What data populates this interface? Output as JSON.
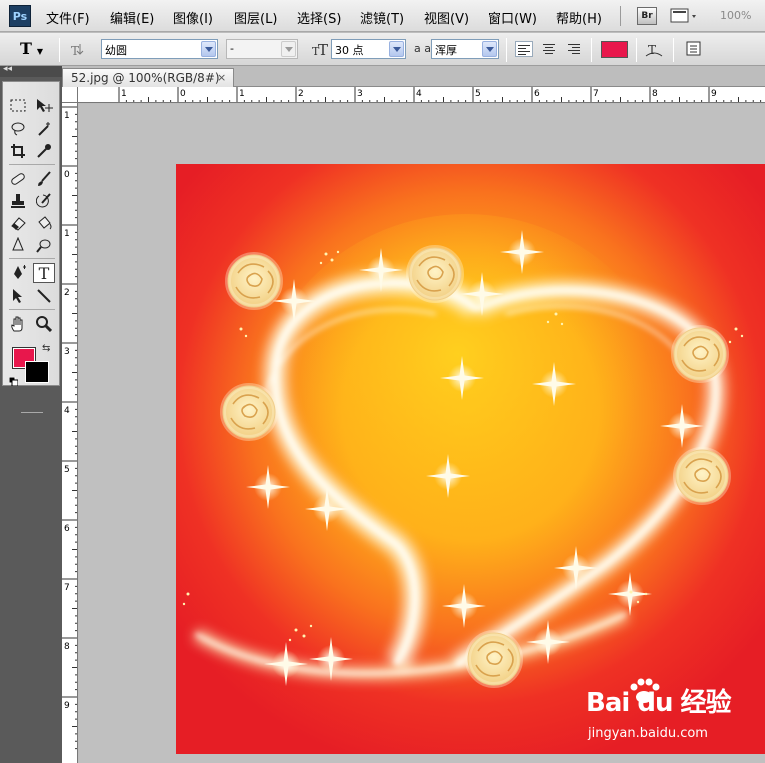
{
  "app": {
    "logo": "Ps"
  },
  "menubar": {
    "items": [
      {
        "label": "文件(F)",
        "id": "file"
      },
      {
        "label": "编辑(E)",
        "id": "edit"
      },
      {
        "label": "图像(I)",
        "id": "image"
      },
      {
        "label": "图层(L)",
        "id": "layer"
      },
      {
        "label": "选择(S)",
        "id": "select"
      },
      {
        "label": "滤镜(T)",
        "id": "filter"
      },
      {
        "label": "视图(V)",
        "id": "view"
      },
      {
        "label": "窗口(W)",
        "id": "window"
      },
      {
        "label": "帮助(H)",
        "id": "help"
      }
    ],
    "bridge_label": "Br",
    "zoom": "100%"
  },
  "options": {
    "tool_letter": "T",
    "font_family": "幼圆",
    "font_style": "-",
    "font_size": "30 点",
    "antialias_label": "a a",
    "antialias": "浑厚",
    "text_color": "#e8174c"
  },
  "toolbox": {
    "foreground": "#e8174c",
    "background": "#000000",
    "active_tool": "T"
  },
  "document": {
    "tab_title": "52.jpg @ 100%(RGB/8#)",
    "close": "×",
    "ruler_top": [
      "1",
      "0",
      "1",
      "2",
      "3",
      "4",
      "5",
      "6",
      "7",
      "8",
      "9"
    ],
    "ruler_left": [
      "1",
      "0",
      "1",
      "2",
      "3",
      "4",
      "5",
      "6",
      "7",
      "8",
      "9"
    ]
  },
  "watermark": {
    "logo": "Bai du 经验",
    "url": "jingyan.baidu.com"
  }
}
